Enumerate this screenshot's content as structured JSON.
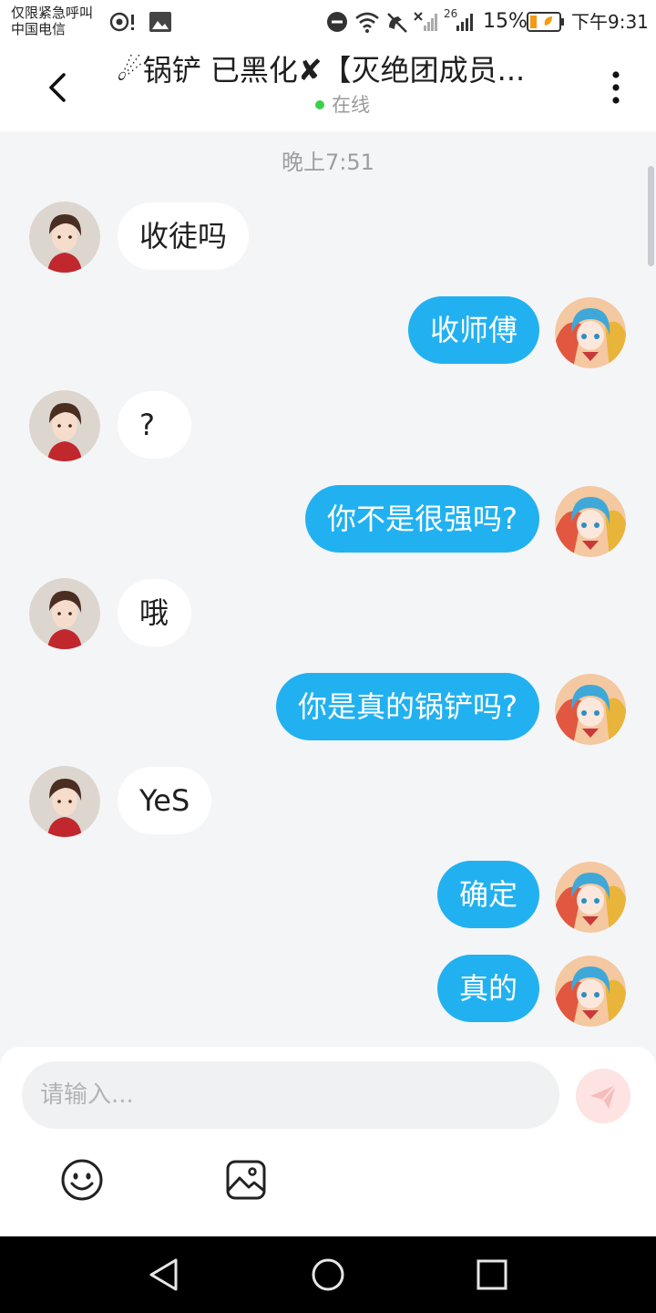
{
  "status_bar": {
    "carrier_line1": "仅限紧急呼叫",
    "carrier_line2": "中国电信",
    "network_label": "26",
    "battery": "15%",
    "time": "下午9:31"
  },
  "header": {
    "title": "☄锅铲 已黑化✘【灭绝团成员...",
    "status": "在线"
  },
  "chat": {
    "timestamp": "晚上7:51",
    "messages": [
      {
        "side": "left",
        "text": "收徒吗"
      },
      {
        "side": "right",
        "text": "收师傅"
      },
      {
        "side": "left",
        "text": "?"
      },
      {
        "side": "right",
        "text": "你不是很强吗?"
      },
      {
        "side": "left",
        "text": "哦"
      },
      {
        "side": "right",
        "text": "你是真的锅铲吗?"
      },
      {
        "side": "left",
        "text": "YeS"
      },
      {
        "side": "right",
        "text": "确定"
      },
      {
        "side": "right",
        "text": "真的"
      }
    ]
  },
  "composer": {
    "placeholder": "请输入..."
  },
  "colors": {
    "accent": "#22b1f0",
    "online": "#3ccf4e",
    "send_bg": "#fde3e2"
  },
  "icons": [
    "back-arrow-icon",
    "more-vertical-icon",
    "send-icon",
    "emoji-icon",
    "image-icon",
    "nav-back-icon",
    "nav-home-icon",
    "nav-recents-icon"
  ]
}
